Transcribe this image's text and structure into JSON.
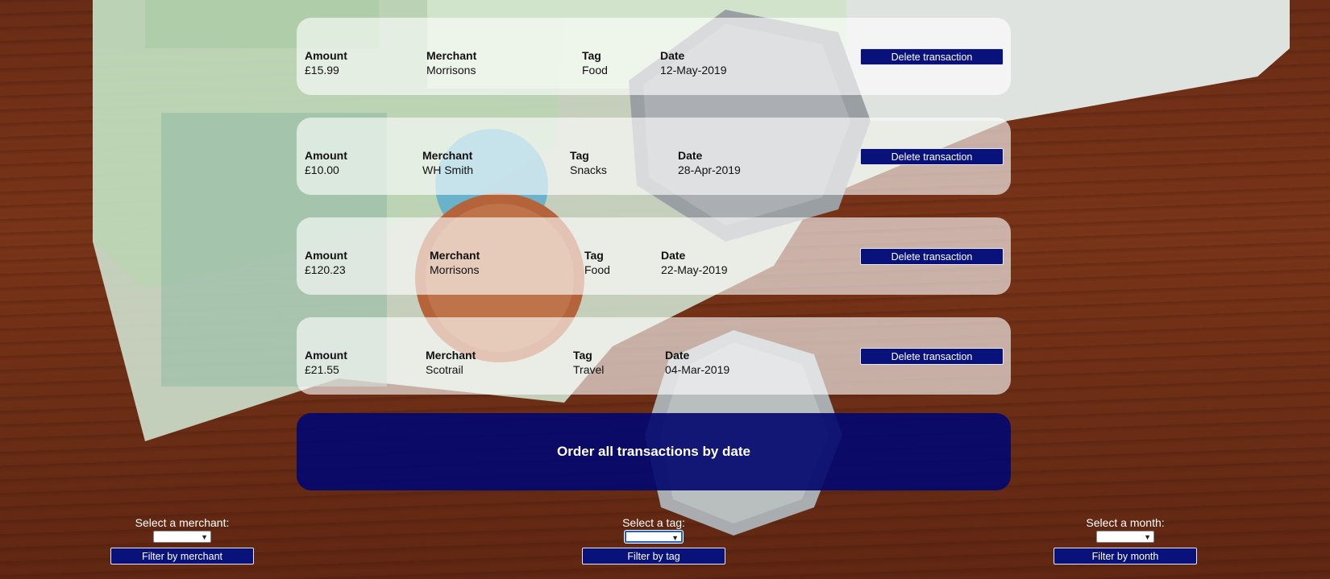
{
  "transactions": [
    {
      "amount_label": "Amount",
      "amount": "£15.99",
      "merchant_label": "Merchant",
      "merchant": "Morrisons",
      "tag_label": "Tag",
      "tag": "Food",
      "date_label": "Date",
      "date": "12-May-2019",
      "delete_label": "Delete transaction"
    },
    {
      "amount_label": "Amount",
      "amount": "£10.00",
      "merchant_label": "Merchant",
      "merchant": "WH Smith",
      "tag_label": "Tag",
      "tag": "Snacks",
      "date_label": "Date",
      "date": "28-Apr-2019",
      "delete_label": "Delete transaction"
    },
    {
      "amount_label": "Amount",
      "amount": "£120.23",
      "merchant_label": "Merchant",
      "merchant": "Morrisons",
      "tag_label": "Tag",
      "tag": "Food",
      "date_label": "Date",
      "date": "22-May-2019",
      "delete_label": "Delete transaction"
    },
    {
      "amount_label": "Amount",
      "amount": "£21.55",
      "merchant_label": "Merchant",
      "merchant": "Scotrail",
      "tag_label": "Tag",
      "tag": "Travel",
      "date_label": "Date",
      "date": "04-Mar-2019",
      "delete_label": "Delete transaction"
    }
  ],
  "order_button": "Order all transactions by date",
  "filters": {
    "merchant": {
      "label": "Select a merchant:",
      "selected": "",
      "button": "Filter by merchant"
    },
    "tag": {
      "label": "Select a tag:",
      "selected": "",
      "button": "Filter by tag"
    },
    "month": {
      "label": "Select a month:",
      "selected": "",
      "button": "Filter by month"
    }
  },
  "colors": {
    "button_bg": "#08127a",
    "card_bg": "rgba(255,255,255,0.62)",
    "wood": "#6a2c16"
  }
}
